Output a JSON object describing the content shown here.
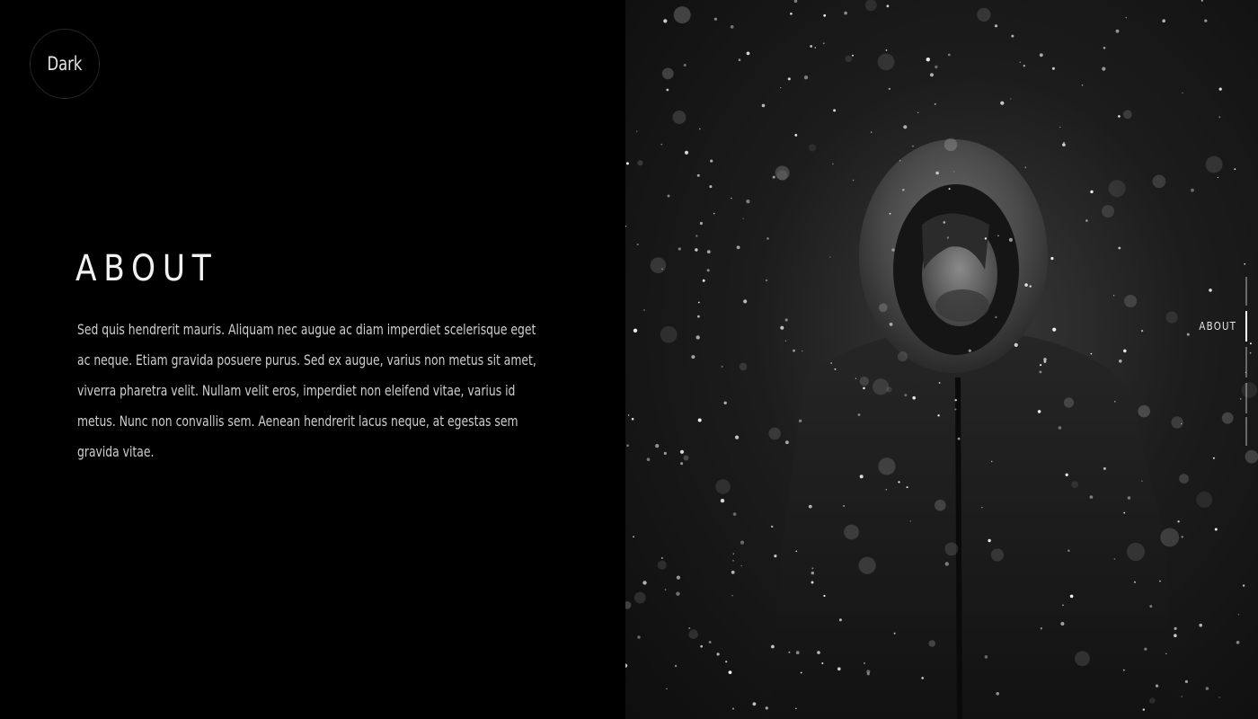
{
  "brand": {
    "logo_label": "Dark"
  },
  "section": {
    "title": "ABOUT",
    "body": "Sed quis hendrerit mauris. Aliquam nec augue ac diam imperdiet scelerisque eget ac neque. Etiam gravida posuere purus. Sed ex augue, varius non metus sit amet, viverra pharetra velit. Nullam velit eros, imperdiet non eleifend vitae, varius id metus. Nunc non convallis sem. Aenean hendrerit lacus neque, at egestas sem gravida vitae."
  },
  "side_nav": {
    "active_label": "ABOUT",
    "items_count_visible": 5
  },
  "colors": {
    "background": "#000000",
    "text": "#e9e9e9",
    "accent": "#ffffff"
  }
}
